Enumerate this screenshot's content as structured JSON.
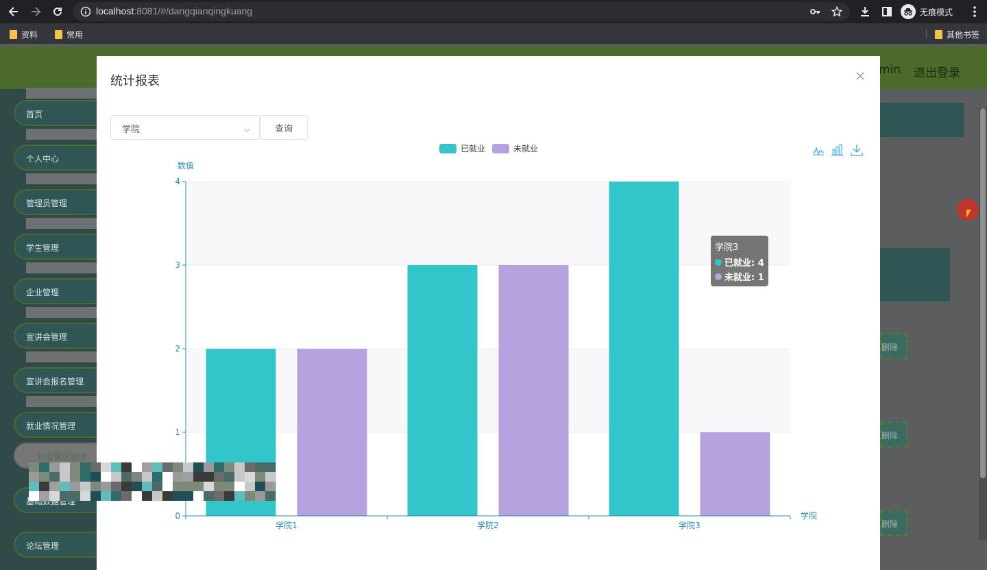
{
  "browser": {
    "url_host": "localhost",
    "url_rest": ":8081/#/dangqianqingkuang",
    "incognito_label": "无痕模式",
    "bookmarks": [
      "资料",
      "常用"
    ],
    "other_bookmarks": "其他书签"
  },
  "app": {
    "header_user": "min",
    "logout": "退出登录",
    "sidebar": [
      {
        "label": "首页"
      },
      {
        "label": "个人中心"
      },
      {
        "label": "管理员管理"
      },
      {
        "label": "学生管理"
      },
      {
        "label": "企业管理"
      },
      {
        "label": "宣讲会管理"
      },
      {
        "label": "宣讲会报名管理"
      },
      {
        "label": "就业情况管理"
      },
      {
        "label": "就业情况管理"
      },
      {
        "label": "基础数据管理"
      },
      {
        "label": "论坛管理"
      }
    ],
    "row_buttons": [
      "删除",
      "删除",
      "删除"
    ]
  },
  "modal": {
    "title": "统计报表",
    "select_value": "学院",
    "query_label": "查询"
  },
  "chart_data": {
    "type": "bar",
    "categories": [
      "学院1",
      "学院2",
      "学院3"
    ],
    "series": [
      {
        "name": "已就业",
        "values": [
          2,
          3,
          4
        ],
        "color": "#32c5c9"
      },
      {
        "name": "未就业",
        "values": [
          2,
          3,
          1
        ],
        "color": "#b6a2de"
      }
    ],
    "xlabel": "学院",
    "ylabel": "数值",
    "ylim": [
      0,
      4
    ],
    "yticks": [
      0,
      1,
      2,
      3,
      4
    ],
    "legend": "top-center",
    "split_area": true,
    "tooltip": {
      "title": "学院3",
      "rows": [
        "已就业: 4",
        "未就业: 1"
      ]
    }
  }
}
